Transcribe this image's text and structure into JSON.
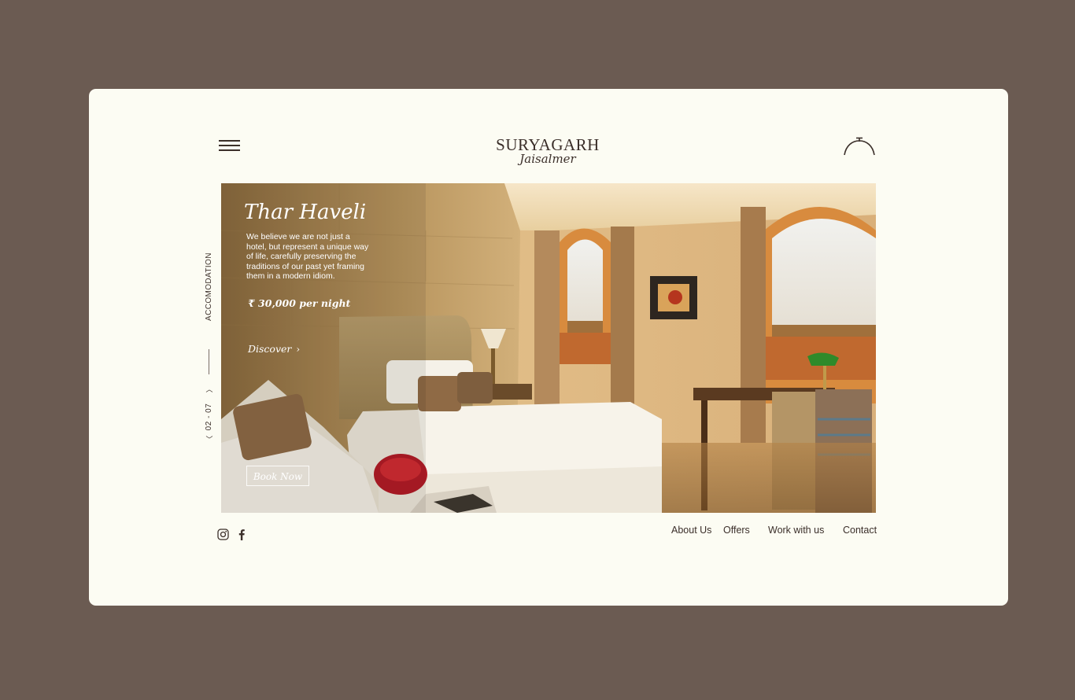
{
  "header": {
    "logo_main": "SURYAGARH",
    "logo_sub": "Jaisalmer",
    "menu_icon": "hamburger-menu-icon",
    "reservation_icon": "cloche-icon"
  },
  "hero": {
    "title": "Thar Haveli",
    "description": "We believe we are not just a hotel, but represent a unique way of life, carefully preserving the traditions of our past yet framing them in a modern idiom.",
    "price": "₹ 30,000 per night",
    "discover_label": "Discover",
    "book_label": "Book Now"
  },
  "side": {
    "section_label": "ACCOMODATION",
    "counter": "02 - 07",
    "up_icon": "chevron-up-icon",
    "down_icon": "chevron-down-icon"
  },
  "social": {
    "instagram_icon": "instagram-icon",
    "facebook_icon": "facebook-icon"
  },
  "footer": {
    "links": [
      "About Us",
      "Offers",
      "Work with us",
      "Contact"
    ]
  },
  "colors": {
    "background": "#6b5b52",
    "card": "#fcfcf3",
    "text": "#3b2f2a"
  }
}
